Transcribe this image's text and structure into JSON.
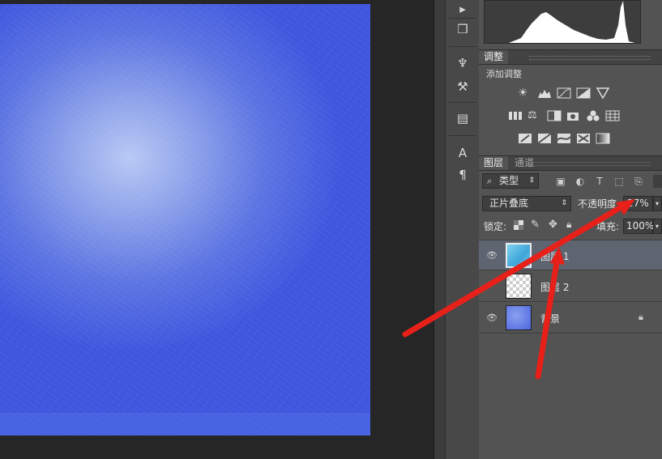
{
  "panels": {
    "adjustments": {
      "tab": "调整",
      "add_label": "添加调整",
      "icon_rows": [
        [
          "brightness-contrast-icon",
          "levels-icon",
          "curves-icon",
          "exposure-icon",
          "vibrance-icon"
        ],
        [
          "hue-saturation-icon",
          "color-balance-icon",
          "black-white-icon",
          "photo-filter-icon",
          "channel-mixer-icon",
          "color-lookup-icon"
        ],
        [
          "invert-icon",
          "posterize-icon",
          "threshold-icon",
          "selective-color-icon",
          "gradient-map-icon"
        ]
      ]
    },
    "layers": {
      "tabs": [
        "图层",
        "通道"
      ],
      "filter_kind": "类型",
      "blend_mode": "正片叠底",
      "opacity_label": "不透明度:",
      "opacity_value": "27%",
      "lock_label": "锁定:",
      "fill_label": "填充:",
      "fill_value": "100%",
      "items": [
        {
          "name": "图层 1",
          "visible": true,
          "selected": true,
          "thumb": "texture"
        },
        {
          "name": "图层 2",
          "visible": false,
          "selected": false,
          "thumb": "transparent"
        },
        {
          "name": "背景",
          "visible": true,
          "selected": false,
          "thumb": "blue",
          "locked": true
        }
      ]
    }
  },
  "colors": {
    "canvas_blue": "#3f57de",
    "panel_bg": "#535353",
    "selected_row": "#5e6470",
    "annotation_red": "#e8201a"
  }
}
